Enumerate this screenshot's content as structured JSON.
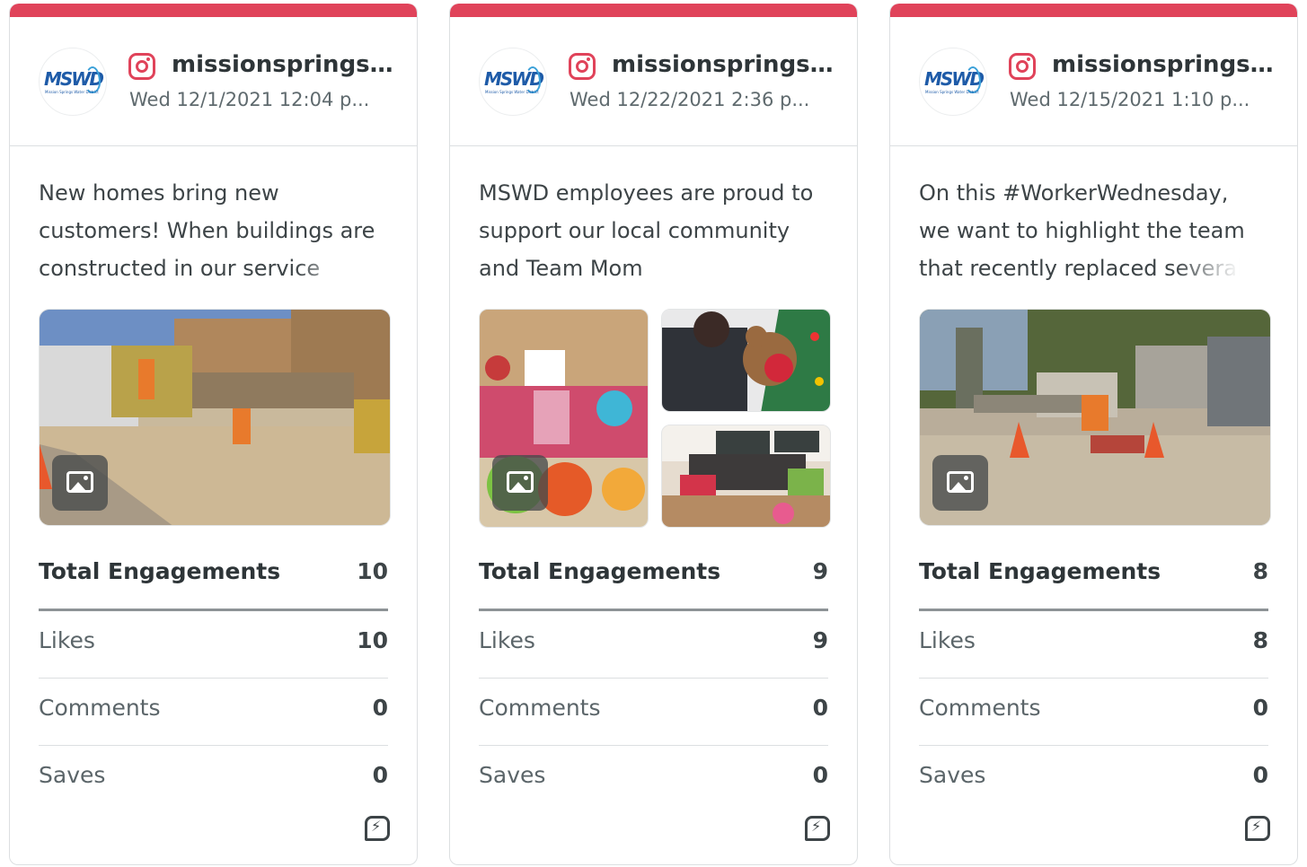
{
  "brand": {
    "accent": "#e0435a",
    "avatar_text": "MSWD",
    "avatar_sub": "Mission Springs Water District"
  },
  "cards": [
    {
      "account": "missionsprings...",
      "date": "Wed 12/1/2021 12:04 p...",
      "text": "New homes bring new customers! When buildings are constructed in our service",
      "media_type": "single-image",
      "stats": {
        "total_label": "Total Engagements",
        "total": "10",
        "likes_label": "Likes",
        "likes": "10",
        "comments_label": "Comments",
        "comments": "0",
        "saves_label": "Saves",
        "saves": "0"
      }
    },
    {
      "account": "missionsprings...",
      "date": "Wed 12/22/2021 2:36 p...",
      "text": "MSWD employees are proud to support our local community and Team Mom",
      "media_type": "gallery",
      "stats": {
        "total_label": "Total Engagements",
        "total": "9",
        "likes_label": "Likes",
        "likes": "9",
        "comments_label": "Comments",
        "comments": "0",
        "saves_label": "Saves",
        "saves": "0"
      }
    },
    {
      "account": "missionsprings...",
      "date": "Wed 12/15/2021 1:10 p...",
      "text": "On this #WorkerWednesday, we want to highlight the team that recently replaced several",
      "media_type": "single-image",
      "stats": {
        "total_label": "Total Engagements",
        "total": "8",
        "likes_label": "Likes",
        "likes": "8",
        "comments_label": "Comments",
        "comments": "0",
        "saves_label": "Saves",
        "saves": "0"
      }
    }
  ]
}
